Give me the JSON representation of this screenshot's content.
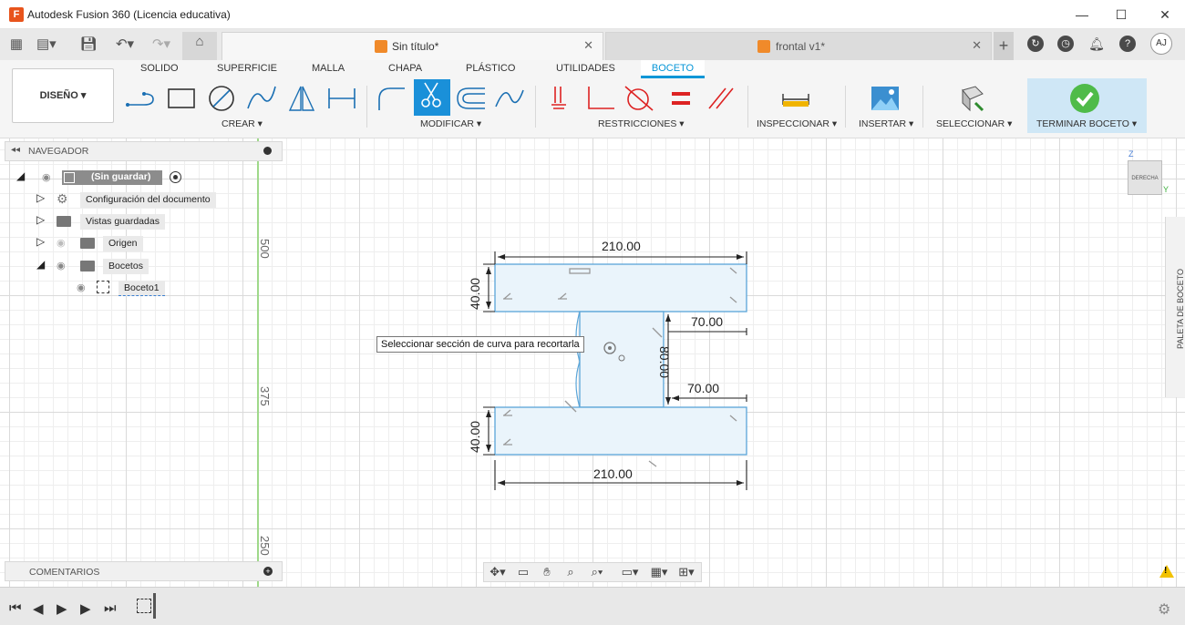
{
  "window": {
    "title": "Autodesk Fusion 360 (Licencia educativa)",
    "minimize": "—",
    "maximize": "☐",
    "close": "✕"
  },
  "tabs": [
    {
      "label": "Sin título*",
      "close": "✕",
      "active": true
    },
    {
      "label": "frontal v1*",
      "close": "✕",
      "active": false
    }
  ],
  "user": {
    "initials": "AJ"
  },
  "ribbon": {
    "workspace": "DISEÑO ▾",
    "tabs": [
      "SOLIDO",
      "SUPERFICIE",
      "MALLA",
      "CHAPA",
      "PLÁSTICO",
      "UTILIDADES",
      "BOCETO"
    ],
    "active_tab": "BOCETO",
    "groups": {
      "create": "CREAR ▾",
      "modify": "MODIFICAR ▾",
      "constraints": "RESTRICCIONES ▾",
      "inspect": "INSPECCIONAR ▾",
      "insert": "INSERTAR ▾",
      "select": "SELECCIONAR ▾",
      "finish": "TERMINAR BOCETO ▾"
    }
  },
  "browser": {
    "title": "NAVEGADOR",
    "items": [
      {
        "label": "(Sin guardar)"
      },
      {
        "label": "Configuración del documento"
      },
      {
        "label": "Vistas guardadas"
      },
      {
        "label": "Origen"
      },
      {
        "label": "Bocetos"
      },
      {
        "label": "Boceto1"
      }
    ]
  },
  "comments": {
    "label": "COMENTARIOS"
  },
  "palette": {
    "label": "PALETA DE BOCETO"
  },
  "viewcube": {
    "face": "DERECHA",
    "axes": [
      "Z",
      "Y"
    ]
  },
  "canvas": {
    "ruler_ticks": [
      "500",
      "375",
      "250"
    ],
    "tooltip": "Seleccionar sección de curva para recortarla",
    "dimensions": {
      "top_width": "210.00",
      "top_height": "40.00",
      "right_upper": "70.00",
      "web_height": "80.00",
      "right_lower": "70.00",
      "bottom_height": "40.00",
      "bottom_width": "210.00"
    }
  },
  "colors": {
    "accent": "#0696d7",
    "sketch_fill": "#eaf4fb",
    "sketch_line": "#5aa5d8",
    "finish_bg": "#cfe7f6",
    "finish_check": "#4fbb49"
  }
}
